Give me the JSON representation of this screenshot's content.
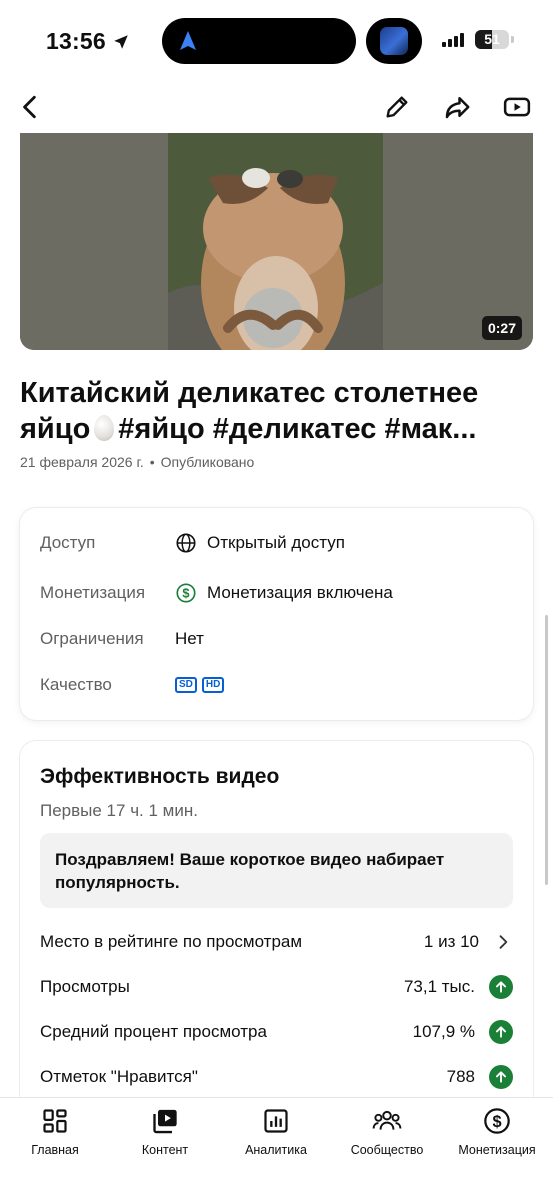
{
  "status_bar": {
    "time": "13:56",
    "battery_percent": "51",
    "battery_level": 0.51
  },
  "toolbar": {
    "back_icon": "chevron-left-icon",
    "edit_icon": "pencil-icon",
    "share_icon": "share-icon",
    "youtube_icon": "youtube-play-icon"
  },
  "video": {
    "duration": "0:27"
  },
  "title_part1": "Китайский деликатес столетнее яйцо",
  "title_part2": "#яйцо #деликатес #мак...",
  "meta": {
    "date": "21 февраля 2026 г.",
    "separator": "•",
    "status": "Опубликовано"
  },
  "details": {
    "access_label": "Доступ",
    "access_value": "Открытый доступ",
    "monetization_label": "Монетизация",
    "monetization_value": "Монетизация включена",
    "restrictions_label": "Ограничения",
    "restrictions_value": "Нет",
    "quality_label": "Качество",
    "quality_badges": [
      "SD",
      "HD"
    ]
  },
  "performance": {
    "title": "Эффективность видео",
    "period": "Первые 17 ч. 1 мин.",
    "congrats": "Поздравляем! Ваше короткое видео набирает популярность.",
    "metrics": [
      {
        "label": "Место в рейтинге по просмотрам",
        "value": "1 из 10",
        "indicator": "chevron-right"
      },
      {
        "label": "Просмотры",
        "value": "73,1 тыс.",
        "indicator": "up-arrow"
      },
      {
        "label": "Средний процент просмотра",
        "value": "107,9 %",
        "indicator": "up-arrow"
      },
      {
        "label": "Отметок \"Нравится\"",
        "value": "788",
        "indicator": "up-arrow"
      }
    ]
  },
  "bottom_nav": [
    {
      "label": "Главная",
      "icon": "dashboard-icon"
    },
    {
      "label": "Контент",
      "icon": "content-icon"
    },
    {
      "label": "Аналитика",
      "icon": "analytics-icon"
    },
    {
      "label": "Сообщество",
      "icon": "community-icon"
    },
    {
      "label": "Монетизация",
      "icon": "monetization-icon"
    }
  ],
  "colors": {
    "positive": "#1a7f37",
    "link": "#065fd4",
    "secondary_text": "#606060"
  }
}
